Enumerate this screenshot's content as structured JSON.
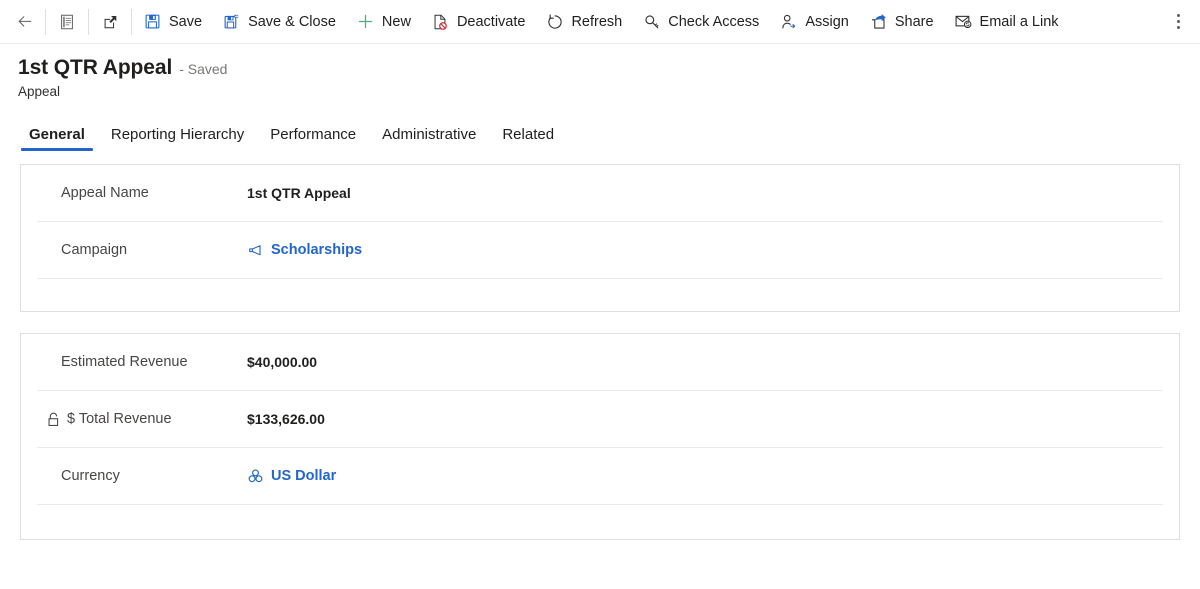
{
  "commandbar": {
    "back": {
      "label": "Back",
      "icon": "back-arrow-icon"
    },
    "form_selector": {
      "label": "Form selector",
      "icon": "form-icon"
    },
    "popout": {
      "label": "Open in new window",
      "icon": "popout-icon"
    },
    "buttons": [
      {
        "label": "Save",
        "icon": "save-icon",
        "name": "save-button"
      },
      {
        "label": "Save & Close",
        "icon": "save-and-close-icon",
        "name": "save-and-close-button"
      },
      {
        "label": "New",
        "icon": "plus-icon",
        "name": "new-button"
      },
      {
        "label": "Deactivate",
        "icon": "deactivate-icon",
        "name": "deactivate-button"
      },
      {
        "label": "Refresh",
        "icon": "refresh-icon",
        "name": "refresh-button"
      },
      {
        "label": "Check Access",
        "icon": "key-icon",
        "name": "check-access-button"
      },
      {
        "label": "Assign",
        "icon": "assign-person-icon",
        "name": "assign-button"
      },
      {
        "label": "Share",
        "icon": "share-icon",
        "name": "share-button"
      },
      {
        "label": "Email a Link",
        "icon": "email-link-icon",
        "name": "email-a-link-button"
      }
    ],
    "overflow": {
      "label": "More commands",
      "icon": "ellipsis-vertical-icon"
    }
  },
  "header": {
    "title": "1st QTR Appeal",
    "saved_status": "- Saved",
    "entity": "Appeal"
  },
  "tabs": [
    {
      "label": "General",
      "active": true
    },
    {
      "label": "Reporting Hierarchy",
      "active": false
    },
    {
      "label": "Performance",
      "active": false
    },
    {
      "label": "Administrative",
      "active": false
    },
    {
      "label": "Related",
      "active": false
    }
  ],
  "cards": [
    {
      "name": "appeal-summary-card",
      "fields": [
        {
          "label": "Appeal Name",
          "value": "1st QTR Appeal",
          "type": "text",
          "locked": false
        },
        {
          "label": "Campaign",
          "value": "Scholarships",
          "type": "lookup",
          "icon": "megaphone-icon",
          "locked": false
        }
      ]
    },
    {
      "name": "revenue-card",
      "fields": [
        {
          "label": "Estimated Revenue",
          "value": "$40,000.00",
          "type": "text",
          "locked": false
        },
        {
          "label": "$ Total Revenue",
          "value": "$133,626.00",
          "type": "text",
          "locked": true,
          "lock_icon": "lock-icon"
        },
        {
          "label": "Currency",
          "value": "US Dollar",
          "type": "lookup",
          "icon": "currency-globe-icon",
          "locked": false
        }
      ]
    }
  ],
  "colors": {
    "accent": "#2266cc",
    "link": "#2266cc",
    "text": "#201f1e",
    "label": "#484644",
    "border": "#e1dfdd",
    "divider": "#edebe9",
    "new_icon": "#4bb07a",
    "deactivate_badge": "#d13438"
  }
}
